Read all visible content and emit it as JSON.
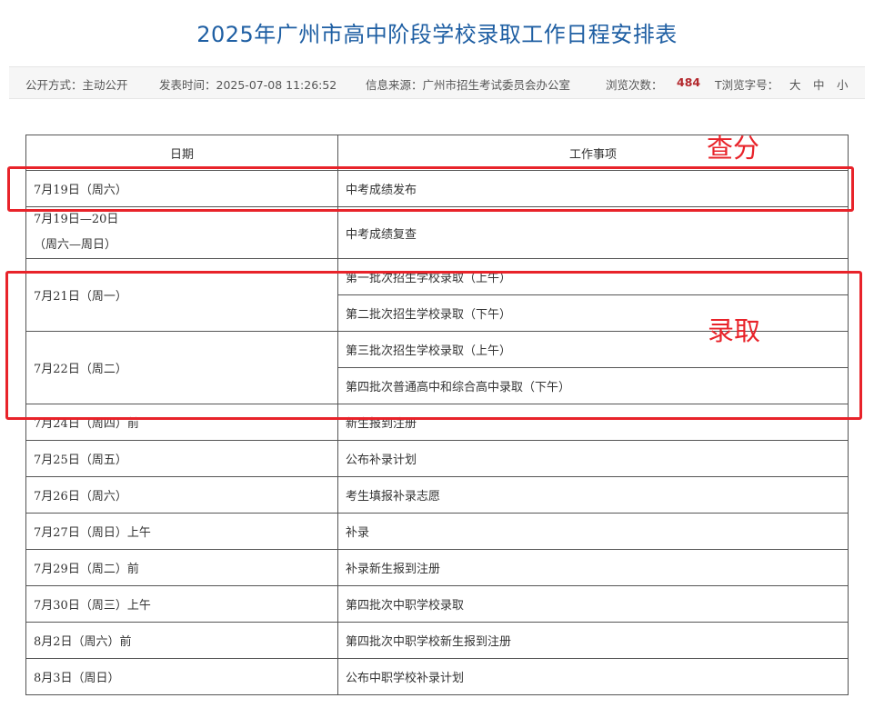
{
  "title": "2025年广州市高中阶段学校录取工作日程安排表",
  "meta": {
    "publish_mode": "公开方式：主动公开",
    "publish_time": "发表时间：2025-07-08 11:26:52",
    "source": "信息来源：广州市招生考试委员会办公室",
    "views_label": "浏览次数：",
    "views_count": "484",
    "font_size_label": "T浏览字号：",
    "font_large": "大",
    "font_medium": "中",
    "font_small": "小"
  },
  "table": {
    "headers": [
      "日期",
      "工作事项"
    ],
    "rows": [
      {
        "date": "7月19日（周六）",
        "item": "中考成绩发布"
      },
      {
        "date_lines": [
          "7月19日—20日",
          "（周六—周日）"
        ],
        "item": "中考成绩复查"
      },
      {
        "date": "7月21日（周一）",
        "items": [
          "第一批次招生学校录取（上午）",
          "第二批次招生学校录取（下午）"
        ]
      },
      {
        "date": "7月22日（周二）",
        "items": [
          "第三批次招生学校录取（上午）",
          "第四批次普通高中和综合高中录取（下午）"
        ]
      },
      {
        "date": "7月24日（周四）前",
        "item": "新生报到注册"
      },
      {
        "date": "7月25日（周五）",
        "item": "公布补录计划"
      },
      {
        "date": "7月26日（周六）",
        "item": "考生填报补录志愿"
      },
      {
        "date": "7月27日（周日）上午",
        "item": "补录"
      },
      {
        "date": "7月29日（周二）前",
        "item": "补录新生报到注册"
      },
      {
        "date": "7月30日（周三）上午",
        "item": "第四批次中职学校录取"
      },
      {
        "date": "8月2日（周六）前",
        "item": "第四批次中职学校新生报到注册"
      },
      {
        "date": "8月3日（周日）",
        "item": "公布中职学校补录计划"
      }
    ]
  },
  "annotations": {
    "score_check": "查分",
    "admission": "录取",
    "color": "#e8232a"
  },
  "colors": {
    "title": "#1f5fa3",
    "views_count": "#b3282d"
  }
}
